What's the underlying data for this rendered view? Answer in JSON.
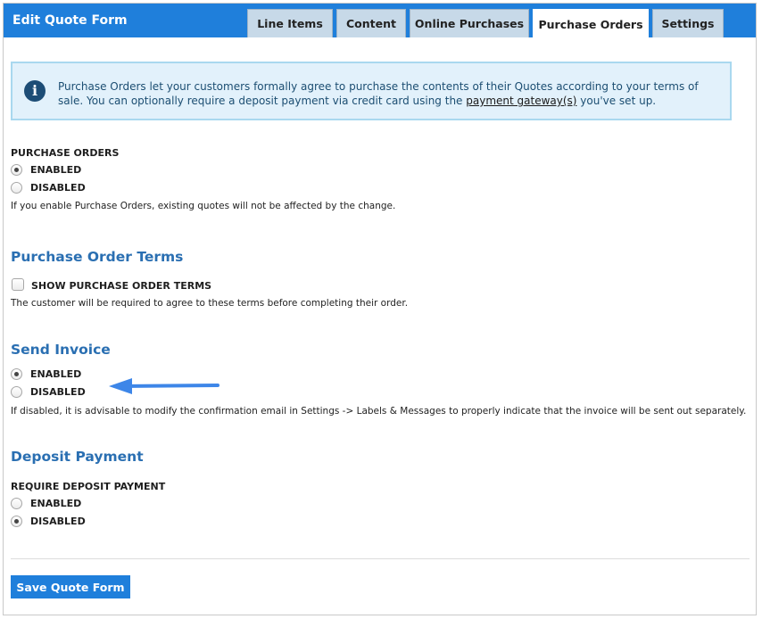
{
  "header": {
    "title": "Edit Quote Form",
    "tabs": [
      {
        "label": "Line Items",
        "active": false
      },
      {
        "label": "Content",
        "active": false
      },
      {
        "label": "Online Purchases",
        "active": false
      },
      {
        "label": "Purchase Orders",
        "active": true
      },
      {
        "label": "Settings",
        "active": false
      }
    ]
  },
  "info": {
    "icon": "info-icon",
    "text_part1": "Purchase Orders let your customers formally agree to purchase the contents of their Quotes according to your terms of sale. You can optionally require a deposit payment via credit card using the ",
    "link_text": "payment gateway(s)",
    "text_part2": " you've set up."
  },
  "purchase_orders": {
    "label": "PURCHASE ORDERS",
    "options": [
      {
        "label": "ENABLED",
        "selected": true
      },
      {
        "label": "DISABLED",
        "selected": false
      }
    ],
    "help": "If you enable Purchase Orders, existing quotes will not be affected by the change."
  },
  "terms": {
    "title": "Purchase Order Terms",
    "checkbox_label": "SHOW PURCHASE ORDER TERMS",
    "checked": false,
    "help": "The customer will be required to agree to these terms before completing their order."
  },
  "send_invoice": {
    "title": "Send Invoice",
    "options": [
      {
        "label": "ENABLED",
        "selected": true
      },
      {
        "label": "DISABLED",
        "selected": false
      }
    ],
    "help": "If disabled, it is advisable to modify the confirmation email in Settings -> Labels & Messages to properly indicate that the invoice will be sent out separately."
  },
  "deposit": {
    "title": "Deposit Payment",
    "label": "REQUIRE DEPOSIT PAYMENT",
    "options": [
      {
        "label": "ENABLED",
        "selected": false
      },
      {
        "label": "DISABLED",
        "selected": true
      }
    ]
  },
  "save_label": "Save Quote Form",
  "colors": {
    "accent": "#1f7fdb",
    "section_title": "#2a6fb2",
    "arrow": "#3d86e8"
  }
}
